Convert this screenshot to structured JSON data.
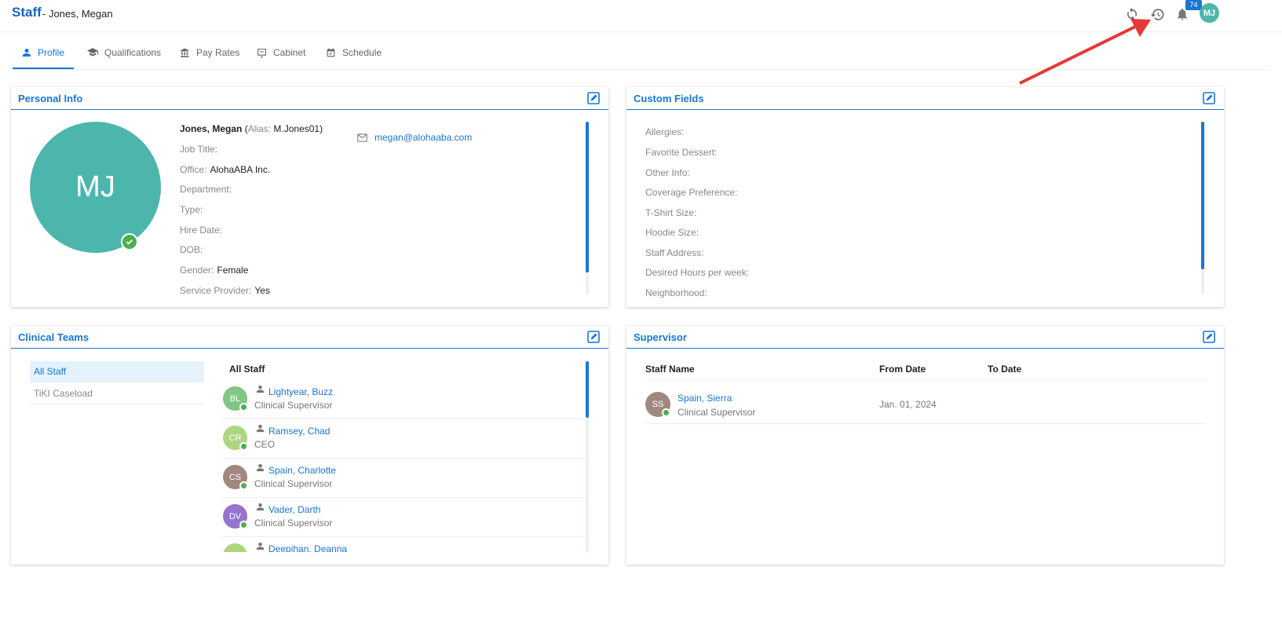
{
  "header": {
    "title": "Staff",
    "subtitle": "- Jones, Megan",
    "notification_count": "74",
    "user_initials": "MJ"
  },
  "tabs": [
    {
      "label": "Profile",
      "icon": "person-icon",
      "active": true
    },
    {
      "label": "Qualifications",
      "icon": "graduation-cap-icon"
    },
    {
      "label": "Pay Rates",
      "icon": "bank-icon"
    },
    {
      "label": "Cabinet",
      "icon": "cabinet-icon"
    },
    {
      "label": "Schedule",
      "icon": "calendar-check-icon"
    }
  ],
  "personal_info": {
    "title": "Personal Info",
    "initials": "MJ",
    "name": "Jones, Megan",
    "alias_label": "Alias:",
    "alias": "M.Jones01",
    "email": "megan@alohaaba.com",
    "rows": [
      {
        "label": "Job Title:",
        "value": ""
      },
      {
        "label": "Office:",
        "value": "AlohaABA Inc."
      },
      {
        "label": "Department:",
        "value": ""
      },
      {
        "label": "Type:",
        "value": ""
      },
      {
        "label": "Hire Date:",
        "value": ""
      },
      {
        "label": "DOB:",
        "value": ""
      },
      {
        "label": "Gender:",
        "value": "Female"
      },
      {
        "label": "Service Provider:",
        "value": "Yes"
      }
    ]
  },
  "custom_fields": {
    "title": "Custom Fields",
    "rows": [
      "Allergies:",
      "Favorite Dessert:",
      "Other Info:",
      "Coverage Preference:",
      "T-Shirt Size:",
      "Hoodie Size:",
      "Staff Address:",
      "Desired Hours per week:",
      "Neighborhood:"
    ]
  },
  "clinical_teams": {
    "title": "Clinical Teams",
    "teams": [
      "All Staff",
      "TiKI Caseload"
    ],
    "list_header": "All Staff",
    "members": [
      {
        "initials": "BL",
        "name": "Lightyear, Buzz",
        "role": "Clinical Supervisor",
        "color": "#81c784"
      },
      {
        "initials": "CR",
        "name": "Ramsey, Chad",
        "role": "CEO",
        "color": "#aed581"
      },
      {
        "initials": "CS",
        "name": "Spain, Charlotte",
        "role": "Clinical Supervisor",
        "color": "#a1887f"
      },
      {
        "initials": "DV",
        "name": "Vader, Darth",
        "role": "Clinical Supervisor",
        "color": "#9575cd"
      },
      {
        "initials": "",
        "name": "Deepihan, Deanna",
        "role": "",
        "color": "#aed581"
      }
    ]
  },
  "supervisor": {
    "title": "Supervisor",
    "columns": [
      "Staff Name",
      "From Date",
      "To Date"
    ],
    "rows": [
      {
        "initials": "SS",
        "name": "Spain, Sierra",
        "role": "Clinical Supervisor",
        "from": "Jan. 01, 2024",
        "to": ""
      }
    ]
  },
  "colors": {
    "accent": "#1976d2",
    "avatar": "#4db6ac",
    "online": "#4caf50",
    "annotation_arrow": "#e53935"
  }
}
